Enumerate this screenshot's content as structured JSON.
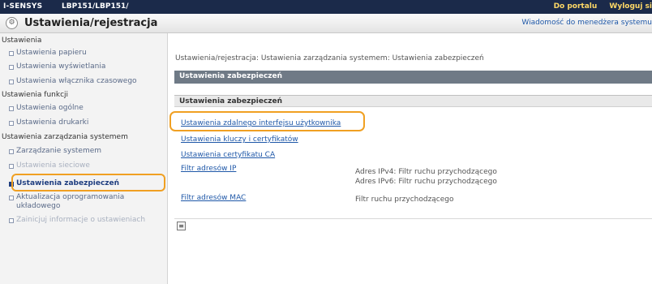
{
  "topbar": {
    "brand": "I-SENSYS",
    "model": "LBP151/LBP151/",
    "portal_link": "Do portalu",
    "logout_link": "Wyloguj si"
  },
  "header": {
    "title": "Ustawienia/rejestracja",
    "message_link": "Wiadomość do menedżera systemu"
  },
  "sidebar": {
    "group1": "Ustawienia",
    "group1_items": [
      "Ustawienia papieru",
      "Ustawienia wyświetlania",
      "Ustawienia włącznika czasowego"
    ],
    "group2": "Ustawienia funkcji",
    "group2_items": [
      "Ustawienia ogólne",
      "Ustawienia drukarki"
    ],
    "group3": "Ustawienia zarządzania systemem",
    "group3_items": [
      "Zarządzanie systemem",
      "Ustawienia sieciowe",
      "Ustawienia zabezpieczeń",
      "Aktualizacja oprogramowania układowego",
      "Zainicjuj informacje o ustawieniach"
    ]
  },
  "main": {
    "breadcrumb": "Ustawienia/rejestracja: Ustawienia zarządzania systemem: Ustawienia zabezpieczeń",
    "section_title": "Ustawienia zabezpieczeń",
    "panel_title": "Ustawienia zabezpieczeń",
    "links": {
      "remote_ui": "Ustawienia zdalnego interfejsu użytkownika",
      "keys": "Ustawienia kluczy i certyfikatów",
      "ca": "Ustawienia certyfikatu CA",
      "ip_filter": "Filtr adresów IP",
      "mac_filter": "Filtr adresów MAC"
    },
    "ip_desc_1": "Adres IPv4: Filtr ruchu przychodzącego",
    "ip_desc_2": "Adres IPv6: Filtr ruchu przychodzącego",
    "mac_desc": "Filtr ruchu przychodzącego",
    "small_button": "≡"
  },
  "colors": {
    "topbar": "#1b2a4a",
    "highlight": "#f0a022",
    "link": "#1f58a8",
    "section_head": "#6f7a86"
  }
}
